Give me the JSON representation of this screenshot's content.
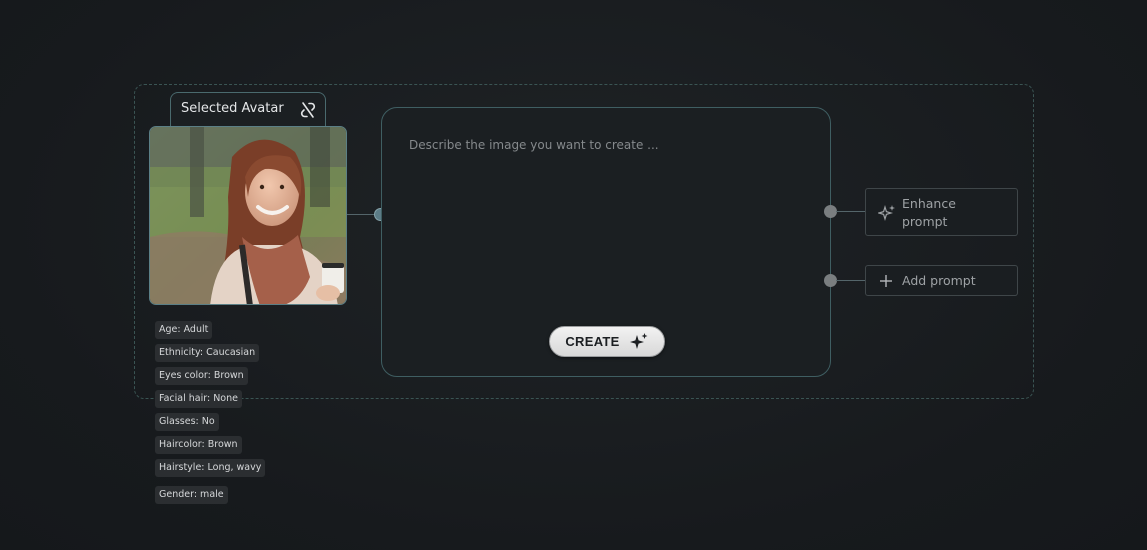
{
  "avatar": {
    "tab_label": "Selected Avatar",
    "tab_icon": "unlink-icon",
    "attributes": [
      {
        "label": "Age: Adult"
      },
      {
        "label": "Ethnicity: Caucasian"
      },
      {
        "label": "Eyes color: Brown"
      },
      {
        "label": "Facial hair: None"
      },
      {
        "label": "Glasses: No"
      },
      {
        "label": "Haircolor: Brown"
      },
      {
        "label": "Hairstyle: Long, wavy"
      },
      {
        "label": "Gender: male"
      }
    ]
  },
  "prompt": {
    "placeholder": "Describe the image you want to create ...",
    "value": ""
  },
  "create_button": {
    "label": "CREATE",
    "icon": "sparkle-icon"
  },
  "side_actions": {
    "enhance": {
      "line1": "Enhance",
      "line2": "prompt",
      "icon": "sparkle-icon"
    },
    "add": {
      "label": "Add prompt",
      "icon": "plus-icon"
    }
  },
  "colors": {
    "background": "#181c1f",
    "accent_border": "#3f5e62",
    "node_active": "#5c7c87",
    "node_inactive": "#7a7e80"
  }
}
